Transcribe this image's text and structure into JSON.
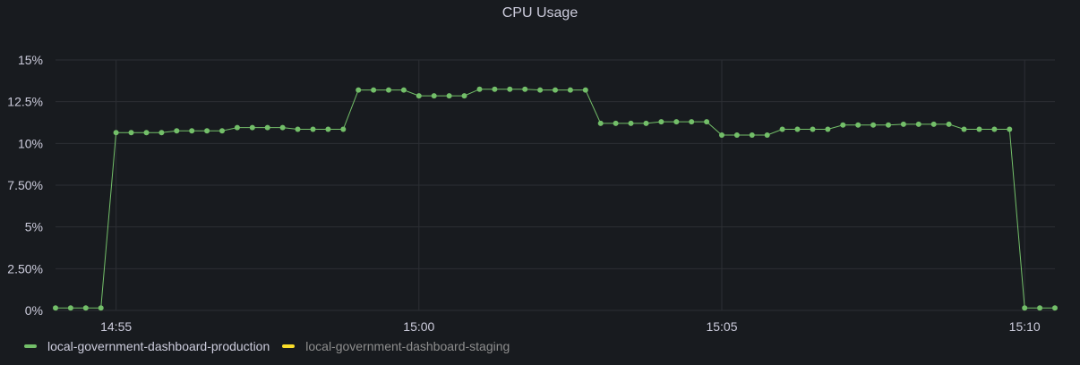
{
  "panel": {
    "title": "CPU Usage"
  },
  "colors": {
    "background": "#181b1f",
    "grid": "#2c2f34",
    "axis_text": "#ccccdc",
    "production": "#73bf69",
    "staging": "#fade2a",
    "legend_active_text": "#ccccdc",
    "legend_inactive_text": "#8e8e8e"
  },
  "legend": {
    "items": [
      {
        "label": "local-government-dashboard-production",
        "color": "#73bf69",
        "active": true
      },
      {
        "label": "local-government-dashboard-staging",
        "color": "#fade2a",
        "active": false
      }
    ]
  },
  "chart_data": {
    "type": "line",
    "title": "CPU Usage",
    "xlabel": "",
    "ylabel": "",
    "ylim": [
      0,
      15
    ],
    "yticks": [
      {
        "value": 0,
        "label": "0%"
      },
      {
        "value": 2.5,
        "label": "2.50%"
      },
      {
        "value": 5,
        "label": "5%"
      },
      {
        "value": 7.5,
        "label": "7.50%"
      },
      {
        "value": 10,
        "label": "10%"
      },
      {
        "value": 12.5,
        "label": "12.5%"
      },
      {
        "value": 15,
        "label": "15%"
      }
    ],
    "xticks": [
      {
        "value": "14:55",
        "label": "14:55"
      },
      {
        "value": "15:00",
        "label": "15:00"
      },
      {
        "value": "15:05",
        "label": "15:05"
      },
      {
        "value": "15:10",
        "label": "15:10"
      }
    ],
    "xlim": [
      "14:54:00",
      "15:10:30"
    ],
    "grid": true,
    "legend_position": "bottom-left",
    "series": [
      {
        "name": "local-government-dashboard-production",
        "color": "#73bf69",
        "x": [
          "14:54:00",
          "14:54:15",
          "14:54:30",
          "14:54:45",
          "14:55:00",
          "14:55:15",
          "14:55:30",
          "14:55:45",
          "14:56:00",
          "14:56:15",
          "14:56:30",
          "14:56:45",
          "14:57:00",
          "14:57:15",
          "14:57:30",
          "14:57:45",
          "14:58:00",
          "14:58:15",
          "14:58:30",
          "14:58:45",
          "14:59:00",
          "14:59:15",
          "14:59:30",
          "14:59:45",
          "15:00:00",
          "15:00:15",
          "15:00:30",
          "15:00:45",
          "15:01:00",
          "15:01:15",
          "15:01:30",
          "15:01:45",
          "15:02:00",
          "15:02:15",
          "15:02:30",
          "15:02:45",
          "15:03:00",
          "15:03:15",
          "15:03:30",
          "15:03:45",
          "15:04:00",
          "15:04:15",
          "15:04:30",
          "15:04:45",
          "15:05:00",
          "15:05:15",
          "15:05:30",
          "15:05:45",
          "15:06:00",
          "15:06:15",
          "15:06:30",
          "15:06:45",
          "15:07:00",
          "15:07:15",
          "15:07:30",
          "15:07:45",
          "15:08:00",
          "15:08:15",
          "15:08:30",
          "15:08:45",
          "15:09:00",
          "15:09:15",
          "15:09:30",
          "15:09:45",
          "15:10:00",
          "15:10:15",
          "15:10:30"
        ],
        "y": [
          0.15,
          0.15,
          0.15,
          0.15,
          10.65,
          10.65,
          10.65,
          10.65,
          10.75,
          10.75,
          10.75,
          10.75,
          10.95,
          10.95,
          10.95,
          10.95,
          10.85,
          10.85,
          10.85,
          10.85,
          13.2,
          13.2,
          13.2,
          13.2,
          12.85,
          12.85,
          12.85,
          12.85,
          13.25,
          13.25,
          13.25,
          13.25,
          13.2,
          13.2,
          13.2,
          13.2,
          11.2,
          11.2,
          11.2,
          11.2,
          11.3,
          11.3,
          11.3,
          11.3,
          10.5,
          10.5,
          10.5,
          10.5,
          10.85,
          10.85,
          10.85,
          10.85,
          11.1,
          11.1,
          11.1,
          11.1,
          11.15,
          11.15,
          11.15,
          11.15,
          10.85,
          10.85,
          10.85,
          10.85,
          0.15,
          0.15,
          0.15
        ]
      }
    ]
  }
}
